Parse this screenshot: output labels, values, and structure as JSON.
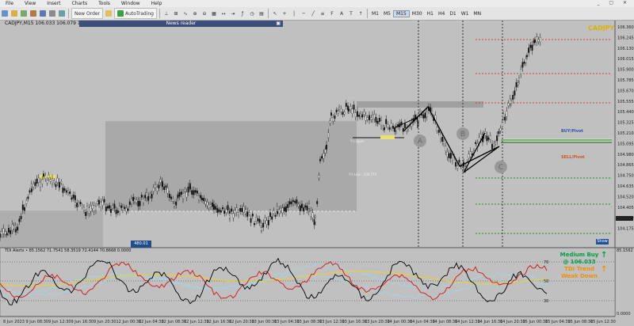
{
  "menu": {
    "items": [
      "File",
      "View",
      "Insert",
      "Charts",
      "Tools",
      "Window",
      "Help"
    ],
    "window_controls": "_ ▢ ✕"
  },
  "toolbar": {
    "new_order": "New Order",
    "auto_trading": "AutoTrading",
    "timeframes": [
      "M1",
      "M5",
      "M15",
      "M30",
      "H1",
      "H4",
      "D1",
      "W1",
      "MN"
    ],
    "active_timeframe": "M15"
  },
  "chart": {
    "title": "CADJPY,M15 106.033 106.079 105.964 106.001",
    "symbol": "CADJPY",
    "news_reader": "News reader",
    "time_box": "480.01",
    "buy_pivot": "BUY/Pivot",
    "sell_pivot": "SELL/Pivot",
    "show_button": "Show",
    "current_price": "106.001",
    "price_labels": [
      "106.360",
      "106.245",
      "106.130",
      "106.015",
      "105.900",
      "105.785",
      "105.670",
      "105.555",
      "105.440",
      "105.325",
      "105.210",
      "105.095",
      "104.980",
      "104.865",
      "104.750",
      "104.635",
      "104.520",
      "104.405",
      "104.290",
      "104.175"
    ],
    "time_labels": [
      "8 Jun 2023",
      "9 Jun 08:30",
      "9 Jun 12:30",
      "9 Jun 16:30",
      "9 Jun 20:30",
      "12 Jun 00:30",
      "12 Jun 04:30",
      "12 Jun 08:30",
      "12 Jun 12:30",
      "12 Jun 16:30",
      "12 Jun 20:30",
      "13 Jun 00:30",
      "13 Jun 04:30",
      "13 Jun 08:30",
      "13 Jun 12:30",
      "13 Jun 16:30",
      "13 Jun 20:30",
      "14 Jun 00:30",
      "14 Jun 04:30",
      "14 Jun 08:30",
      "14 Jun 12:30",
      "14 Jun 16:30",
      "14 Jun 20:30",
      "15 Jun 00:30",
      "15 Jun 04:30",
      "15 Jun 08:30",
      "15 Jun 12:30"
    ],
    "pattern_labels": [
      "A",
      "B",
      "C"
    ],
    "zone_labels": [
      "Y's Open",
      "Y's Low : 104.774"
    ]
  },
  "indicator": {
    "label": "TDI Alerts • 85.1562 71.7541 58.3519 72.4144 70.8668 0.0000",
    "levels": [
      "70",
      "50",
      "30"
    ],
    "signal1_line1": "Medium Buy",
    "signal1_line2": "@ 106.033",
    "signal2_line1": "TDI Trend",
    "signal2_line2": "Weak Down",
    "right_labels": [
      "85.1562",
      "0.0000"
    ]
  },
  "colors": {
    "chart_bg": "#c0c0c0",
    "candle": "#1a1a1a",
    "zone_dark": "#a9a9a9",
    "zone_light": "#b8b8b8",
    "buy": "#2a5aa8",
    "sell": "#d2541f",
    "green_signal": "#00a040",
    "orange_signal": "#f09000",
    "news_bar": "#3c4e7a"
  }
}
